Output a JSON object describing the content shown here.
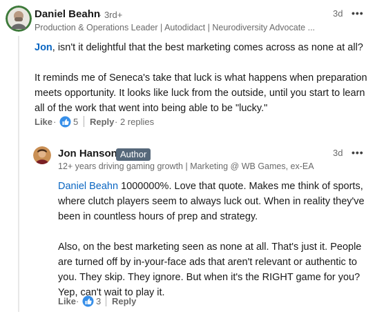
{
  "comment": {
    "author": "Daniel Beahn",
    "degree": "· 3rd+",
    "headline": "Production & Operations Leader | Autodidact | Neurodiversity Advocate ...",
    "time": "3d",
    "more": "•••",
    "mention": "Jon",
    "line1_rest": ", isn't it delightful that the best marketing comes across as none at all?",
    "para2": "It reminds me of Seneca's take that luck is what happens when preparation meets opportunity. It looks like luck from the outside, until you start to learn all of the work that went into being able to be \"lucky.\"",
    "like_label": "Like",
    "like_dot": "·",
    "reaction_count": "5",
    "reply_label": "Reply",
    "replies_count": "· 2 replies"
  },
  "reply": {
    "author": "Jon Hanson",
    "badge": "Author",
    "headline": "12+ years driving gaming growth | Marketing @ WB Games, ex-EA",
    "time": "3d",
    "more": "•••",
    "mention": "Daniel Beahn",
    "para1_rest": " 1000000%. Love that quote. Makes me think of sports, where clutch players seem to always luck out. When in reality they've been in countless hours of prep and strategy.",
    "para2": "Also, on the best marketing seen as none at all. That's just it. People are turned off by in-your-face ads that aren't relevant or authentic to you. They skip. They ignore. But when it's the RIGHT game for you? Yep, can't wait to play it.",
    "like_label": "Like",
    "like_dot": "·",
    "reaction_count": "3",
    "reply_label": "Reply"
  },
  "colors": {
    "link": "#0a66c2",
    "badge_bg": "#56687a",
    "like_icon": "#378fe9"
  }
}
